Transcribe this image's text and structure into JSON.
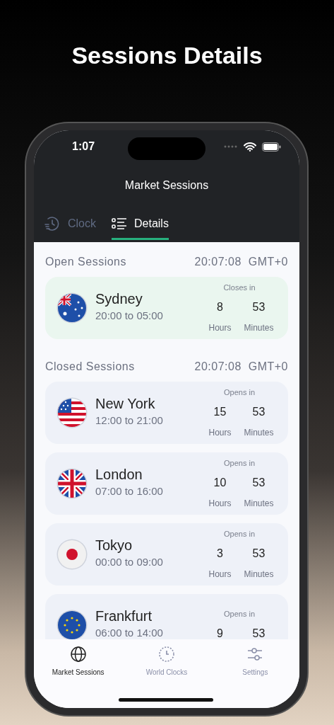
{
  "headline": "Sessions Details",
  "status_bar": {
    "time": "1:07"
  },
  "app_bar": {
    "title": "Market Sessions"
  },
  "tabs": [
    {
      "label": "Clock",
      "selected": false
    },
    {
      "label": "Details",
      "selected": true
    }
  ],
  "sections": [
    {
      "title": "Open Sessions",
      "time": "20:07:08",
      "timezone": "GMT+0",
      "kind": "open",
      "sessions": [
        {
          "city": "Sydney",
          "kind": "australia",
          "hours_range": "20:00 to 05:00",
          "countdown_label": "Closes in",
          "hours": "8",
          "hours_label": "Hours",
          "minutes": "53",
          "minutes_label": "Minutes"
        }
      ]
    },
    {
      "title": "Closed Sessions",
      "time": "20:07:08",
      "timezone": "GMT+0",
      "kind": "closed",
      "sessions": [
        {
          "city": "New York",
          "kind": "usa",
          "hours_range": "12:00 to 21:00",
          "countdown_label": "Opens in",
          "hours": "15",
          "hours_label": "Hours",
          "minutes": "53",
          "minutes_label": "Minutes"
        },
        {
          "city": "London",
          "kind": "uk",
          "hours_range": "07:00 to 16:00",
          "countdown_label": "Opens in",
          "hours": "10",
          "hours_label": "Hours",
          "minutes": "53",
          "minutes_label": "Minutes"
        },
        {
          "city": "Tokyo",
          "kind": "japan",
          "hours_range": "00:00 to 09:00",
          "countdown_label": "Opens in",
          "hours": "3",
          "hours_label": "Hours",
          "minutes": "53",
          "minutes_label": "Minutes"
        },
        {
          "city": "Frankfurt",
          "kind": "eu",
          "hours_range": "06:00 to 14:00",
          "countdown_label": "Opens in",
          "hours": "9",
          "minutes": "53"
        }
      ]
    }
  ],
  "bottom_nav": [
    {
      "label": "Market Sessions",
      "selected": true
    },
    {
      "label": "World Clocks",
      "selected": false
    },
    {
      "label": "Settings",
      "selected": false
    }
  ]
}
